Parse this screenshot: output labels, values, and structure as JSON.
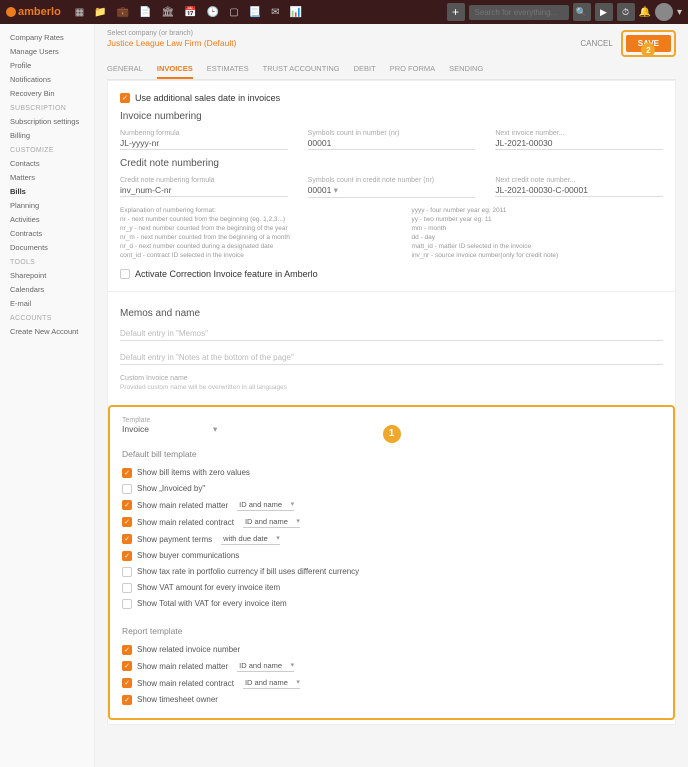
{
  "topbar": {
    "brand": "amberlo",
    "search_placeholder": "Search for everything..."
  },
  "sidebar": {
    "groups": [
      {
        "header": null,
        "items": [
          "Company Rates",
          "Manage Users",
          "Profile",
          "Notifications",
          "Recovery Bin"
        ]
      },
      {
        "header": "SUBSCRIPTION",
        "items": [
          "Subscription settings",
          "Billing"
        ]
      },
      {
        "header": "CUSTOMIZE",
        "items": [
          "Contacts",
          "Matters",
          "Bills",
          "Planning",
          "Activities",
          "Contracts",
          "Documents"
        ],
        "active": "Bills"
      },
      {
        "header": "TOOLS",
        "items": [
          "Sharepoint",
          "Calendars",
          "E-mail"
        ]
      },
      {
        "header": "ACCOUNTS",
        "items": [
          "Create New Account"
        ]
      }
    ]
  },
  "header": {
    "select_label": "Select company (or branch)",
    "company": "Justice League Law Firm (Default)",
    "cancel": "CANCEL",
    "save": "SAVE"
  },
  "tabs": [
    "GENERAL",
    "INVOICES",
    "ESTIMATES",
    "TRUST ACCOUNTING",
    "DEBIT",
    "PRO FORMA",
    "SENDING"
  ],
  "active_tab": "INVOICES",
  "invoice": {
    "use_additional": "Use additional sales date in invoices",
    "numbering_title": "Invoice numbering",
    "fields": {
      "formula_label": "Numbering formula",
      "formula_value": "JL-yyyy-nr",
      "symbols_label": "Symbols count in number (nr)",
      "symbols_value": "00001",
      "next_label": "Next invoice number...",
      "next_value": "JL-2021-00030"
    },
    "credit_title": "Credit note numbering",
    "credit_fields": {
      "formula_label": "Credit note numbering formula",
      "formula_value": "inv_num-C-nr",
      "symbols_label": "Symbols count in credit note number (nr)",
      "symbols_value": "00001",
      "next_label": "Next credit note number...",
      "next_value": "JL-2021-00030-C-00001"
    },
    "explain_left": "Explanation of numbering format:\nnr - next number counted from the beginning (eg. 1,2,3...)\nnr_y - next number counted from the beginning of the year\nnr_m - next number counted from the beginning of a month\nnr_d - next number counted during a designated date\ncont_id - contract ID selected in the invoice",
    "explain_right": "yyyy - four number year eg. 2011\nyy - two number year eg. 11\nmm - month\ndd - day\nmatt_id - matter ID selected in the invoice\ninv_nr - source invoice number(only for credit note)",
    "activate_correction": "Activate Correction Invoice feature in Amberlo",
    "memos_title": "Memos and name",
    "memos_ph": "Default entry in \"Memos\"",
    "notes_ph": "Default entry in \"Notes at the bottom of the page\"",
    "custom_name_label": "Custom Invoice name",
    "custom_name_hint": "Provided custom name will be overwritten in all languages"
  },
  "template_box": {
    "template_label": "Template",
    "template_value": "Invoice",
    "default_title": "Default bill template",
    "opts": [
      {
        "checked": true,
        "label": "Show bill items with zero values"
      },
      {
        "checked": false,
        "label": "Show „Invoiced by\""
      },
      {
        "checked": true,
        "label": "Show main related matter",
        "select": "ID and name"
      },
      {
        "checked": true,
        "label": "Show main related contract",
        "select": "ID and name"
      },
      {
        "checked": true,
        "label": "Show payment terms",
        "select": "with due date"
      },
      {
        "checked": true,
        "label": "Show buyer communications"
      },
      {
        "checked": false,
        "label": "Show tax rate in portfolio currency if bill uses different currency"
      },
      {
        "checked": false,
        "label": "Show VAT amount for every invoice item"
      },
      {
        "checked": false,
        "label": "Show Total with VAT for every invoice item"
      }
    ],
    "report_title": "Report template",
    "report_opts": [
      {
        "checked": true,
        "label": "Show related invoice number"
      },
      {
        "checked": true,
        "label": "Show main related matter",
        "select": "ID and name"
      },
      {
        "checked": true,
        "label": "Show main related contract",
        "select": "ID and name"
      },
      {
        "checked": true,
        "label": "Show timesheet owner"
      }
    ]
  }
}
